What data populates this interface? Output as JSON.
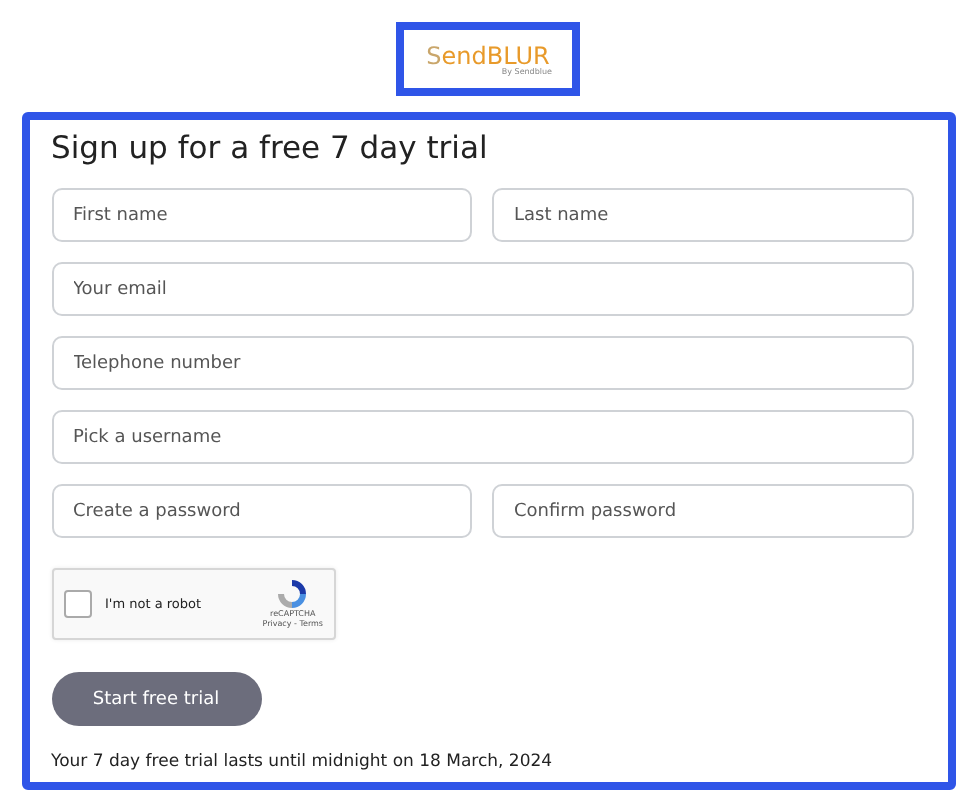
{
  "logo": {
    "prefix": "S",
    "name": "endBLUR",
    "byline": "By Sendblue"
  },
  "form": {
    "title": "Sign up for a free 7 day trial",
    "rows": [
      [
        {
          "placeholder": "First name"
        },
        {
          "placeholder": "Last name"
        }
      ],
      [
        {
          "placeholder": "Your email"
        }
      ],
      [
        {
          "placeholder": "Telephone number"
        }
      ],
      [
        {
          "placeholder": "Pick a username"
        }
      ],
      [
        {
          "placeholder": "Create a password"
        },
        {
          "placeholder": "Confirm password"
        }
      ]
    ],
    "captcha": {
      "label": "I'm not a robot",
      "checked": false,
      "brand": "reCAPTCHA",
      "links": "Privacy - Terms"
    },
    "submit": "Start free trial",
    "note": "Your 7 day free trial lasts until midnight on 18 March, 2024"
  }
}
